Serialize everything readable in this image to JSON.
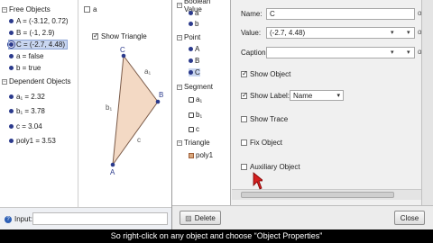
{
  "algebra": {
    "free_heading": "Free Objects",
    "free_items": [
      {
        "text": "A = (-3.12, 0.72)",
        "visible": true
      },
      {
        "text": "B = (-1, 2.9)",
        "visible": true
      },
      {
        "text": "C = (-2.7, 4.48)",
        "visible": true,
        "selected": true
      },
      {
        "text": "a = false",
        "visible": true
      },
      {
        "text": "b = true",
        "visible": true
      }
    ],
    "dependent_heading": "Dependent Objects",
    "dependent_items": [
      {
        "text": "a₁ = 2.32"
      },
      {
        "text": "b₁ = 3.78"
      },
      {
        "text": "c = 3.04"
      },
      {
        "text": "poly1 = 3.53"
      }
    ]
  },
  "graphics": {
    "checkbox_a_label": "a",
    "checkbox_show_triangle_label": "Show Triangle",
    "show_triangle_checked": true,
    "point_labels": {
      "A": "A",
      "B": "B",
      "C": "C"
    },
    "side_labels": {
      "a1": "a₁",
      "b1": "b₁",
      "c": "c"
    },
    "triangle_fill": "#f3d9c4",
    "triangle_stroke": "#7a5a48",
    "point_color": "#2b3a8c"
  },
  "input_bar": {
    "label": "Input:",
    "value": ""
  },
  "properties": {
    "tree": {
      "boolean_heading": "Boolean Value",
      "boolean_items": [
        "a",
        "b"
      ],
      "point_heading": "Point",
      "point_items": [
        "A",
        "B",
        "C"
      ],
      "segment_heading": "Segment",
      "segment_items": [
        "a₁",
        "b₁",
        "c"
      ],
      "triangle_heading": "Triangle",
      "triangle_items": [
        "poly1"
      ]
    },
    "fields": {
      "name_label": "Name:",
      "name_value": "C",
      "value_label": "Value:",
      "value_value": "(-2.7, 4.48)",
      "caption_label": "Caption:",
      "caption_value": ""
    },
    "options": {
      "show_object": {
        "label": "Show Object",
        "checked": true
      },
      "show_label": {
        "label": "Show Label:",
        "checked": true,
        "select_value": "Name"
      },
      "show_trace": {
        "label": "Show Trace",
        "checked": false
      },
      "fix_object": {
        "label": "Fix Object",
        "checked": false
      },
      "auxiliary_object": {
        "label": "Auxiliary Object",
        "checked": false
      }
    },
    "buttons": {
      "delete_label": "Delete",
      "close_label": "Close"
    }
  },
  "caption": "So right-click on any object and choose “Object Properties”"
}
